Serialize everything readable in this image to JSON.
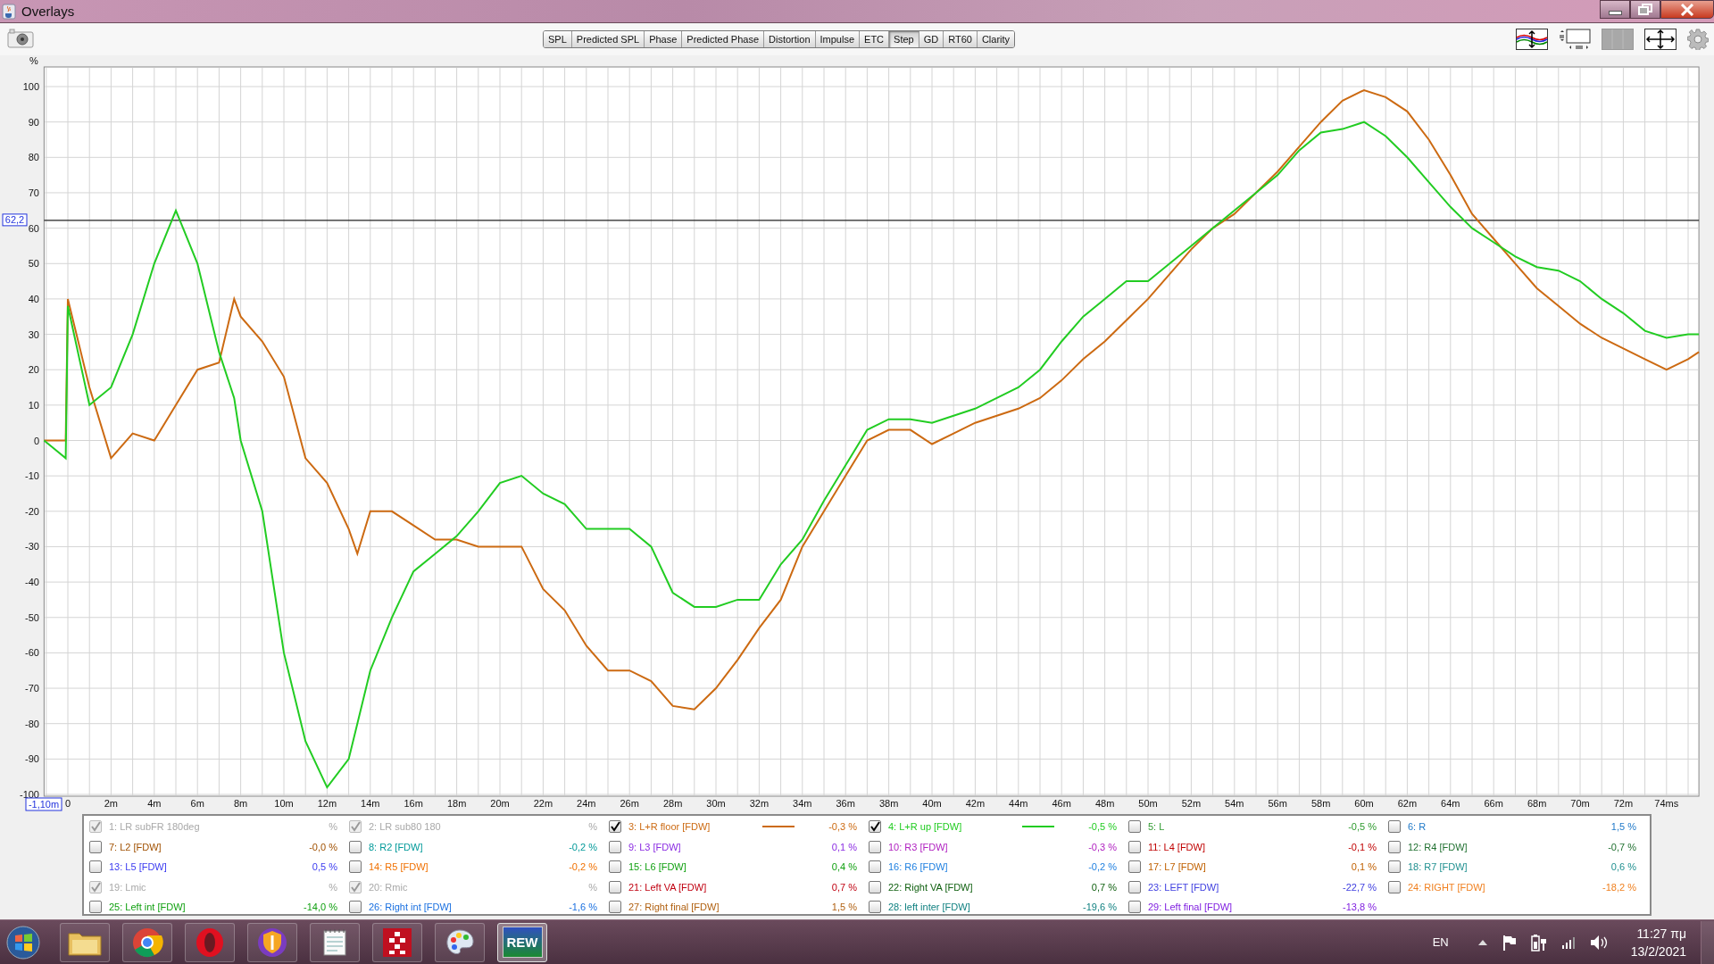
{
  "window": {
    "title": "Overlays"
  },
  "tabs": [
    {
      "label": "SPL",
      "selected": false
    },
    {
      "label": "Predicted SPL",
      "selected": false
    },
    {
      "label": "Phase",
      "selected": false
    },
    {
      "label": "Predicted Phase",
      "selected": false
    },
    {
      "label": "Distortion",
      "selected": false
    },
    {
      "label": "Impulse",
      "selected": false
    },
    {
      "label": "ETC",
      "selected": false
    },
    {
      "label": "Step",
      "selected": true
    },
    {
      "label": "GD",
      "selected": false
    },
    {
      "label": "RT60",
      "selected": false
    },
    {
      "label": "Clarity",
      "selected": false
    }
  ],
  "chart": {
    "cursor_label": "-1,10m",
    "chart_data": {
      "type": "line",
      "ylabel": "%",
      "grid": true,
      "xlim": [
        -1.1,
        75.5
      ],
      "ylim": [
        -100,
        100
      ],
      "yticks": [
        -100,
        -90,
        -80,
        -70,
        -60,
        -50,
        -40,
        -30,
        -20,
        -10,
        0,
        10,
        20,
        30,
        40,
        50,
        60,
        70,
        80,
        90,
        100
      ],
      "xticks": [
        {
          "value": 0,
          "label": "0"
        },
        {
          "value": 2,
          "label": "2m"
        },
        {
          "value": 4,
          "label": "4m"
        },
        {
          "value": 6,
          "label": "6m"
        },
        {
          "value": 8,
          "label": "8m"
        },
        {
          "value": 10,
          "label": "10m"
        },
        {
          "value": 12,
          "label": "12m"
        },
        {
          "value": 14,
          "label": "14m"
        },
        {
          "value": 16,
          "label": "16m"
        },
        {
          "value": 18,
          "label": "18m"
        },
        {
          "value": 20,
          "label": "20m"
        },
        {
          "value": 22,
          "label": "22m"
        },
        {
          "value": 24,
          "label": "24m"
        },
        {
          "value": 26,
          "label": "26m"
        },
        {
          "value": 28,
          "label": "28m"
        },
        {
          "value": 30,
          "label": "30m"
        },
        {
          "value": 32,
          "label": "32m"
        },
        {
          "value": 34,
          "label": "34m"
        },
        {
          "value": 36,
          "label": "36m"
        },
        {
          "value": 38,
          "label": "38m"
        },
        {
          "value": 40,
          "label": "40m"
        },
        {
          "value": 42,
          "label": "42m"
        },
        {
          "value": 44,
          "label": "44m"
        },
        {
          "value": 46,
          "label": "46m"
        },
        {
          "value": 48,
          "label": "48m"
        },
        {
          "value": 50,
          "label": "50m"
        },
        {
          "value": 52,
          "label": "52m"
        },
        {
          "value": 54,
          "label": "54m"
        },
        {
          "value": 56,
          "label": "56m"
        },
        {
          "value": 58,
          "label": "58m"
        },
        {
          "value": 60,
          "label": "60m"
        },
        {
          "value": 62,
          "label": "62m"
        },
        {
          "value": 64,
          "label": "64m"
        },
        {
          "value": 66,
          "label": "66m"
        },
        {
          "value": 68,
          "label": "68m"
        },
        {
          "value": 70,
          "label": "70m"
        },
        {
          "value": 72,
          "label": "72m"
        },
        {
          "value": 74,
          "label": "74ms"
        }
      ],
      "x": [
        -1.1,
        -0.1,
        0,
        1,
        2,
        3,
        4,
        5,
        6,
        7,
        7.7,
        8,
        9,
        10,
        11,
        12,
        13,
        13.4,
        14,
        15,
        16,
        17,
        18,
        19,
        20,
        21,
        22,
        23,
        24,
        25,
        26,
        27,
        28,
        29,
        30,
        31,
        32,
        33,
        34,
        35,
        36,
        37,
        38,
        39,
        40,
        41,
        42,
        43,
        44,
        45,
        46,
        47,
        48,
        49,
        50,
        51,
        52,
        53,
        54,
        55,
        56,
        57,
        58,
        59,
        60,
        61,
        62,
        63,
        64,
        65,
        66,
        67,
        68,
        69,
        70,
        71,
        72,
        73,
        74,
        75,
        75.5
      ],
      "series": [
        {
          "color": "#cc6a12",
          "values": [
            0,
            0,
            40,
            15,
            -5,
            2,
            0,
            10,
            20,
            22,
            40,
            35,
            28,
            18,
            -5,
            -12,
            -25,
            -32,
            -20,
            -20,
            -24,
            -28,
            -28,
            -30,
            -30,
            -30,
            -42,
            -48,
            -58,
            -65,
            -65,
            -68,
            -75,
            -76,
            -70,
            -62,
            -53,
            -45,
            -30,
            -20,
            -10,
            0,
            3,
            3,
            -1,
            2,
            5,
            7,
            9,
            12,
            17,
            23,
            28,
            34,
            40,
            47,
            54,
            60,
            64,
            70,
            76,
            83,
            90,
            96,
            99,
            97,
            93,
            85,
            75,
            64,
            57,
            50,
            43,
            38,
            33,
            29,
            26,
            23,
            20,
            23,
            25
          ]
        },
        {
          "color": "#22cc22",
          "values": [
            0,
            -5,
            38,
            10,
            15,
            30,
            50,
            65,
            50,
            25,
            12,
            0,
            -20,
            -60,
            -85,
            -98,
            -90,
            -80,
            -65,
            -50,
            -37,
            -32,
            -27,
            -20,
            -12,
            -10,
            -15,
            -18,
            -25,
            -25,
            -25,
            -30,
            -43,
            -47,
            -47,
            -45,
            -45,
            -35,
            -28,
            -17,
            -7,
            3,
            6,
            6,
            5,
            7,
            9,
            12,
            15,
            20,
            28,
            35,
            40,
            45,
            45,
            50,
            55,
            60,
            65,
            70,
            75,
            82,
            87,
            88,
            90,
            86,
            80,
            73,
            66,
            60,
            56,
            52,
            49,
            48,
            45,
            40,
            36,
            31,
            29,
            30,
            30
          ]
        }
      ],
      "ref_lines": [
        {
          "axis": "y",
          "value": 62.2,
          "label": "62,2"
        }
      ]
    }
  },
  "legend": [
    {
      "label": "1: LR subFR 180deg",
      "value": "%",
      "checked": true,
      "disabled": true
    },
    {
      "label": "2: LR sub80 180",
      "value": "%",
      "checked": true,
      "disabled": true
    },
    {
      "label": "3: L+R floor [FDW]",
      "value": "-0,3 %",
      "checked": true,
      "disabled": false,
      "color": "#cc6a12"
    },
    {
      "label": "4: L+R up [FDW]",
      "value": "-0,5 %",
      "checked": true,
      "disabled": false,
      "color": "#22cc22"
    },
    {
      "label": "5: L",
      "value": "-0,5 %",
      "checked": false,
      "disabled": false,
      "color": "#2e9a2e"
    },
    {
      "label": "6: R",
      "value": "1,5 %",
      "checked": false,
      "disabled": false,
      "color": "#1e78c8"
    },
    {
      "label": "7: L2 [FDW]",
      "value": "-0,0 %",
      "checked": false,
      "disabled": false,
      "color": "#a05000"
    },
    {
      "label": "8: R2 [FDW]",
      "value": "-0,2 %",
      "checked": false,
      "disabled": false,
      "color": "#009999"
    },
    {
      "label": "9: L3 [FDW]",
      "value": "0,1 %",
      "checked": false,
      "disabled": false,
      "color": "#8a2be2"
    },
    {
      "label": "10: R3 [FDW]",
      "value": "-0,3 %",
      "checked": false,
      "disabled": false,
      "color": "#b020c0"
    },
    {
      "label": "11: L4 [FDW]",
      "value": "-0,1 %",
      "checked": false,
      "disabled": false,
      "color": "#c00000"
    },
    {
      "label": "12: R4 [FDW]",
      "value": "-0,7 %",
      "checked": false,
      "disabled": false,
      "color": "#207030"
    },
    {
      "label": "13: L5 [FDW]",
      "value": "0,5 %",
      "checked": false,
      "disabled": false,
      "color": "#3a3af0"
    },
    {
      "label": "14: R5 [FDW]",
      "value": "-0,2 %",
      "checked": false,
      "disabled": false,
      "color": "#f07000"
    },
    {
      "label": "15: L6 [FDW]",
      "value": "0,4 %",
      "checked": false,
      "disabled": false,
      "color": "#10a010"
    },
    {
      "label": "16: R6 [FDW]",
      "value": "-0,2 %",
      "checked": false,
      "disabled": false,
      "color": "#2080e0"
    },
    {
      "label": "17: L7 [FDW]",
      "value": "0,1 %",
      "checked": false,
      "disabled": false,
      "color": "#c06000"
    },
    {
      "label": "18: R7 [FDW]",
      "value": "0,6 %",
      "checked": false,
      "disabled": false,
      "color": "#209090"
    },
    {
      "label": "19: Lmic",
      "value": "%",
      "checked": true,
      "disabled": true
    },
    {
      "label": "20: Rmic",
      "value": "%",
      "checked": true,
      "disabled": true
    },
    {
      "label": "21: Left VA [FDW]",
      "value": "0,7 %",
      "checked": false,
      "disabled": false,
      "color": "#c00010"
    },
    {
      "label": "22: Right VA [FDW]",
      "value": "0,7 %",
      "checked": false,
      "disabled": false,
      "color": "#106010"
    },
    {
      "label": "23: LEFT [FDW]",
      "value": "-22,7 %",
      "checked": false,
      "disabled": false,
      "color": "#4040e0"
    },
    {
      "label": "24: RIGHT [FDW]",
      "value": "-18,2 %",
      "checked": false,
      "disabled": false,
      "color": "#f08020"
    },
    {
      "label": "25: Left int [FDW]",
      "value": "-14,0 %",
      "checked": false,
      "disabled": false,
      "color": "#10a010"
    },
    {
      "label": "26: Right int [FDW]",
      "value": "-1,6 %",
      "checked": false,
      "disabled": false,
      "color": "#1a70e0"
    },
    {
      "label": "27: Right final [FDW]",
      "value": "1,5 %",
      "checked": false,
      "disabled": false,
      "color": "#b06010"
    },
    {
      "label": "28: left inter [FDW]",
      "value": "-19,6 %",
      "checked": false,
      "disabled": false,
      "color": "#108080"
    },
    {
      "label": "29: Left final [FDW]",
      "value": "-13,8 %",
      "checked": false,
      "disabled": false,
      "color": "#8020e0"
    }
  ],
  "taskbar": {
    "apps": [
      {
        "kind": "folder",
        "selected": false
      },
      {
        "kind": "chrome",
        "selected": false
      },
      {
        "kind": "opera",
        "selected": false
      },
      {
        "kind": "shield",
        "selected": false
      },
      {
        "kind": "notepad",
        "selected": false
      },
      {
        "kind": "grid",
        "selected": false
      },
      {
        "kind": "palette",
        "selected": false
      },
      {
        "kind": "rew",
        "label": "REW",
        "selected": true
      }
    ],
    "language": "EN",
    "time": "11:27 πμ",
    "date": "13/2/2021"
  }
}
